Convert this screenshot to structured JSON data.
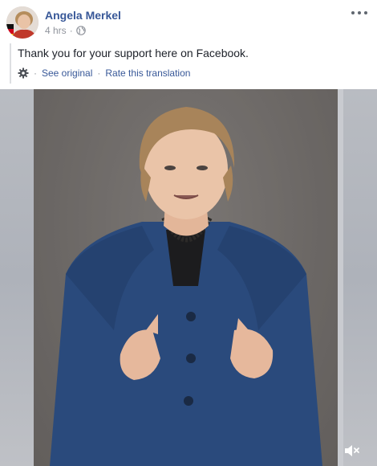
{
  "post": {
    "author": "Angela Merkel",
    "timestamp": "4 hrs",
    "separator": "·",
    "audience_icon": "globe-icon",
    "options_icon": "more-options-icon",
    "translated_text": "Thank you for your support here on Facebook.",
    "see_original": "See original",
    "link_separator": "·",
    "rate_translation": "Rate this translation",
    "settings_icon": "gear-icon"
  },
  "video": {
    "mute_icon": "speaker-muted-icon"
  },
  "colors": {
    "author_link": "#385898",
    "meta_text": "#90949c",
    "body_text": "#1d2129",
    "jacket": "#2a4a7c"
  }
}
